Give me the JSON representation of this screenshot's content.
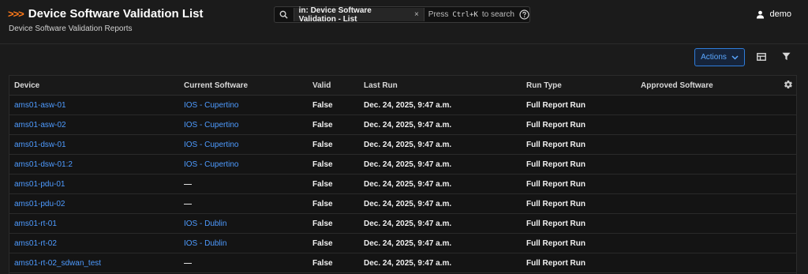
{
  "header": {
    "prefix": ">>>",
    "title": "Device Software Validation List",
    "subtitle": "Device Software Validation Reports"
  },
  "search": {
    "chip": "in: Device Software Validation - List",
    "chip_close": "×",
    "hint_press": "Press",
    "hint_key": "Ctrl+K",
    "hint_to": "to search"
  },
  "user": {
    "name": "demo"
  },
  "toolbar": {
    "actions_label": "Actions"
  },
  "table": {
    "columns": [
      "Device",
      "Current Software",
      "Valid",
      "Last Run",
      "Run Type",
      "Approved Software"
    ],
    "rows": [
      {
        "device": "ams01-asw-01",
        "software": "IOS - Cupertino",
        "valid": "False",
        "last_run": "Dec. 24, 2025, 9:47 a.m.",
        "run_type": "Full Report Run",
        "approved": ""
      },
      {
        "device": "ams01-asw-02",
        "software": "IOS - Cupertino",
        "valid": "False",
        "last_run": "Dec. 24, 2025, 9:47 a.m.",
        "run_type": "Full Report Run",
        "approved": ""
      },
      {
        "device": "ams01-dsw-01",
        "software": "IOS - Cupertino",
        "valid": "False",
        "last_run": "Dec. 24, 2025, 9:47 a.m.",
        "run_type": "Full Report Run",
        "approved": ""
      },
      {
        "device": "ams01-dsw-01:2",
        "software": "IOS - Cupertino",
        "valid": "False",
        "last_run": "Dec. 24, 2025, 9:47 a.m.",
        "run_type": "Full Report Run",
        "approved": ""
      },
      {
        "device": "ams01-pdu-01",
        "software": "—",
        "valid": "False",
        "last_run": "Dec. 24, 2025, 9:47 a.m.",
        "run_type": "Full Report Run",
        "approved": ""
      },
      {
        "device": "ams01-pdu-02",
        "software": "—",
        "valid": "False",
        "last_run": "Dec. 24, 2025, 9:47 a.m.",
        "run_type": "Full Report Run",
        "approved": ""
      },
      {
        "device": "ams01-rt-01",
        "software": "IOS - Dublin",
        "valid": "False",
        "last_run": "Dec. 24, 2025, 9:47 a.m.",
        "run_type": "Full Report Run",
        "approved": ""
      },
      {
        "device": "ams01-rt-02",
        "software": "IOS - Dublin",
        "valid": "False",
        "last_run": "Dec. 24, 2025, 9:47 a.m.",
        "run_type": "Full Report Run",
        "approved": ""
      },
      {
        "device": "ams01-rt-02_sdwan_test",
        "software": "—",
        "valid": "False",
        "last_run": "Dec. 24, 2025, 9:47 a.m.",
        "run_type": "Full Report Run",
        "approved": ""
      }
    ]
  },
  "colors": {
    "accent": "#ff7a1a",
    "link": "#4e9bff",
    "primary_border": "#2f7ddb"
  }
}
